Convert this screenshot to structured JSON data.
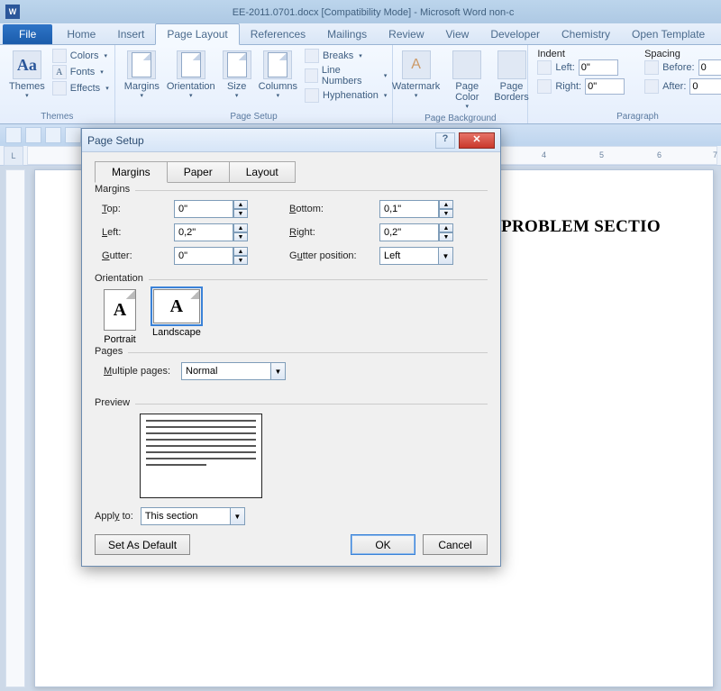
{
  "titlebar": {
    "doc": "EE-2011.0701.docx [Compatibility Mode]",
    "app": "Microsoft Word non-c",
    "sep": " - "
  },
  "ribbonTabs": {
    "file": "File",
    "items": [
      "Home",
      "Insert",
      "Page Layout",
      "References",
      "Mailings",
      "Review",
      "View",
      "Developer",
      "Chemistry",
      "Open Template"
    ],
    "activeIndex": 2
  },
  "ribbon": {
    "themes": {
      "label": "Themes",
      "btn": "Themes",
      "colors": "Colors",
      "fonts": "Fonts",
      "effects": "Effects"
    },
    "pageSetup": {
      "label": "Page Setup",
      "margins": "Margins",
      "orientation": "Orientation",
      "size": "Size",
      "columns": "Columns",
      "breaks": "Breaks",
      "lineNumbers": "Line Numbers",
      "hyphenation": "Hyphenation"
    },
    "pageBackground": {
      "label": "Page Background",
      "watermark": "Watermark",
      "pageColor": "Page\nColor",
      "pageBorders": "Page\nBorders"
    },
    "paragraph": {
      "label": "Paragraph",
      "indent": "Indent",
      "spacing": "Spacing",
      "leftLabel": "Left:",
      "rightLabel": "Right:",
      "beforeLabel": "Before:",
      "afterLabel": "After:",
      "left": "0\"",
      "right": "0\"",
      "before": "0",
      "after": "0"
    }
  },
  "document": {
    "visibleText": "HE PROBLEM SECTIO"
  },
  "ruler": {
    "corner": "L",
    "ticks": [
      "4",
      "5",
      "6",
      "7"
    ]
  },
  "dialog": {
    "title": "Page Setup",
    "tabs": [
      "Margins",
      "Paper",
      "Layout"
    ],
    "activeTab": 0,
    "sections": {
      "margins": "Margins",
      "orientation": "Orientation",
      "pages": "Pages",
      "preview": "Preview"
    },
    "margins": {
      "topLabel": "Top:",
      "top": "0\"",
      "bottomLabel": "Bottom:",
      "bottom": "0,1\"",
      "leftLabel": "Left:",
      "left": "0,2\"",
      "rightLabel": "Right:",
      "right": "0,2\"",
      "gutterLabel": "Gutter:",
      "gutter": "0\"",
      "gutterPosLabel": "Gutter position:",
      "gutterPos": "Left"
    },
    "orientation": {
      "portrait": "Portrait",
      "landscape": "Landscape",
      "selected": "landscape"
    },
    "pages": {
      "label": "Multiple pages:",
      "value": "Normal"
    },
    "apply": {
      "label": "Apply to:",
      "value": "This section"
    },
    "buttons": {
      "default": "Set As Default",
      "ok": "OK",
      "cancel": "Cancel"
    }
  }
}
